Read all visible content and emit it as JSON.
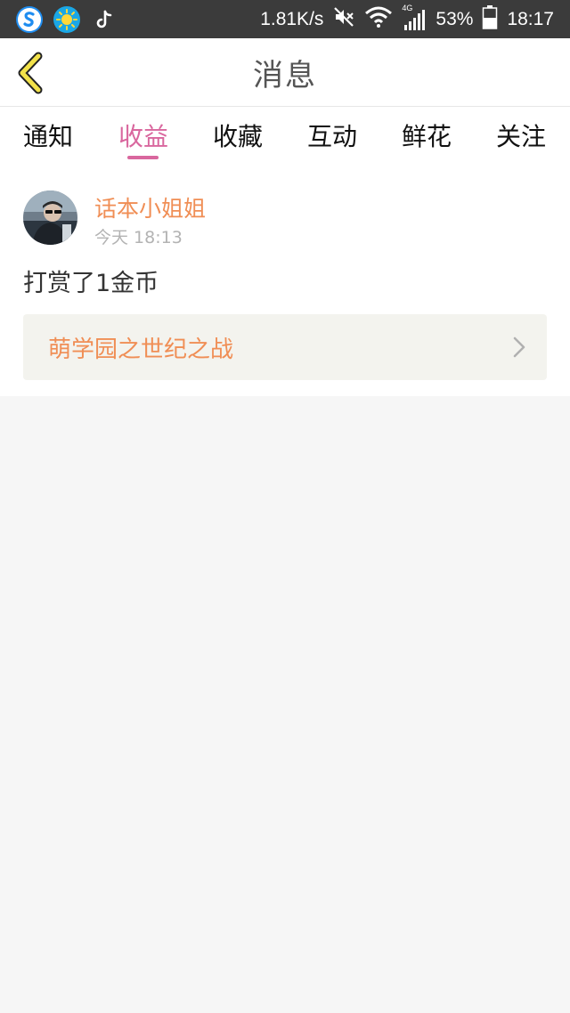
{
  "status_bar": {
    "net_speed": "1.81K/s",
    "network_type": "4G",
    "battery": "53%",
    "time": "18:17",
    "icons": [
      "browser-icon",
      "weather-icon",
      "tiktok-icon",
      "mute-icon",
      "wifi-icon",
      "signal-icon",
      "battery-icon"
    ]
  },
  "header": {
    "title": "消息",
    "back_icon": "chevron-left-icon"
  },
  "tabs": [
    {
      "label": "通知",
      "active": false
    },
    {
      "label": "收益",
      "active": true
    },
    {
      "label": "收藏",
      "active": false
    },
    {
      "label": "互动",
      "active": false
    },
    {
      "label": "鲜花",
      "active": false
    },
    {
      "label": "关注",
      "active": false
    }
  ],
  "message": {
    "username": "话本小姐姐",
    "time": "今天 18:13",
    "text": "打赏了1金币",
    "book_title": "萌学园之世纪之战"
  },
  "colors": {
    "accent_pink": "#d9679e",
    "accent_orange": "#f08e55",
    "back_icon_yellow": "#f2e24a",
    "status_bar_bg": "#3b3b3b",
    "page_bg": "#f6f6f6"
  }
}
